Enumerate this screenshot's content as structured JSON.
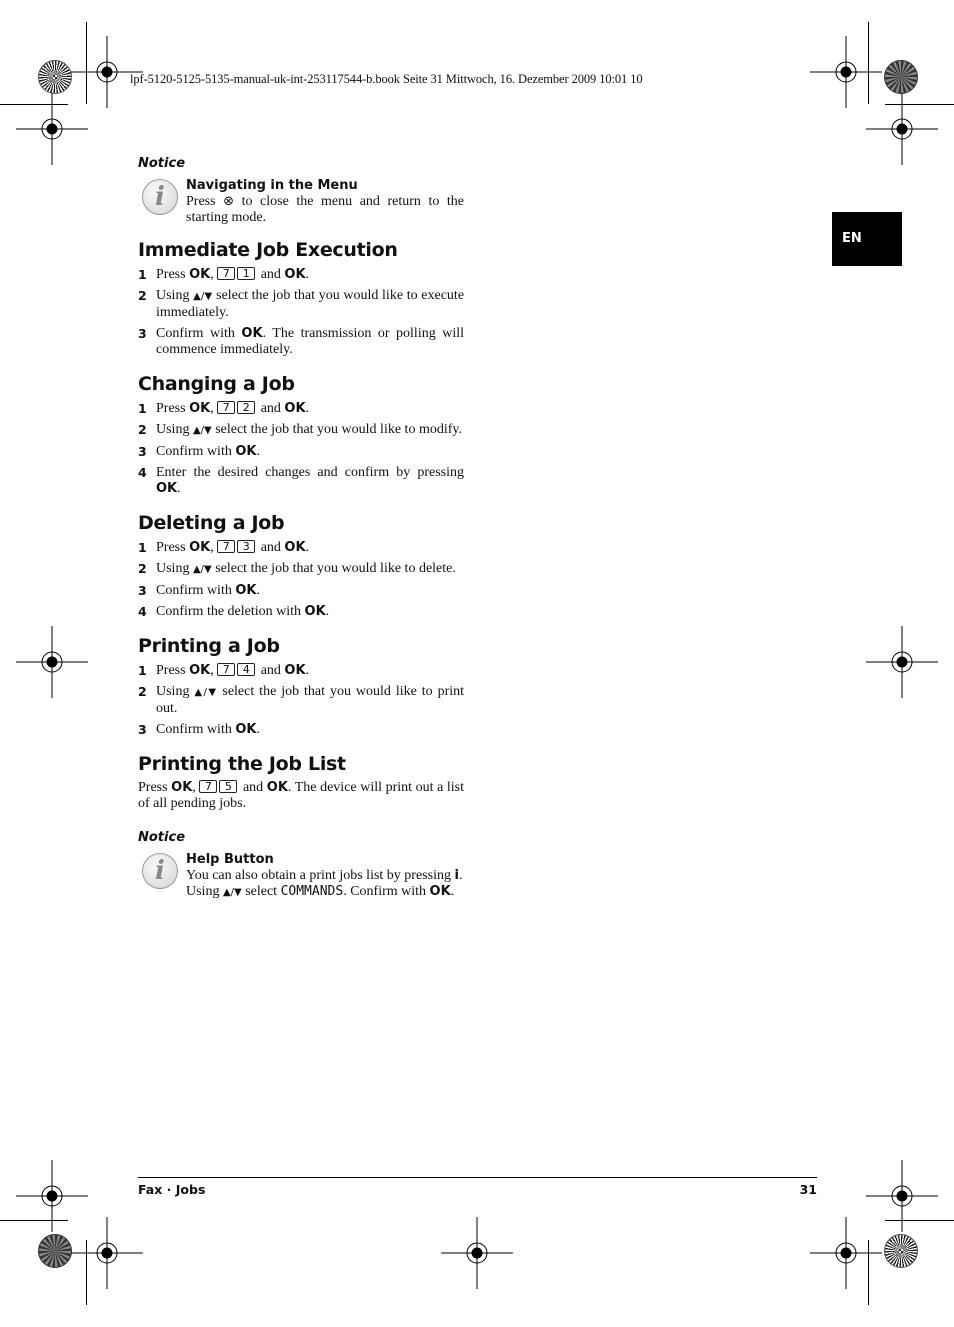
{
  "slug_line": "lpf-5120-5125-5135-manual-uk-int-253117544-b.book  Seite 31  Mittwoch, 16. Dezember 2009  10:01 10",
  "language_tab": "EN",
  "notice1": {
    "label": "Notice",
    "icon": "info-icon",
    "title": "Navigating in the Menu",
    "text_before": "Press",
    "symbol": "⊗",
    "text_after": "to close the menu and return to the starting mode."
  },
  "sections": [
    {
      "title": "Immediate Job Execution",
      "steps": [
        {
          "n": "1",
          "pre": "Press",
          "ok1": "OK",
          "keys": [
            "7",
            "1"
          ],
          "mid": "and",
          "ok2": "OK",
          "end": "."
        },
        {
          "n": "2",
          "pre": "Using",
          "arrows": "▲/▼",
          "text": "select the job that you would like to execute immediately."
        },
        {
          "n": "3",
          "pre": "Confirm with",
          "ok": "OK",
          "text": ". The transmission or polling will commence immediately."
        }
      ]
    },
    {
      "title": "Changing a Job",
      "steps": [
        {
          "n": "1",
          "pre": "Press",
          "ok1": "OK",
          "keys": [
            "7",
            "2"
          ],
          "mid": "and",
          "ok2": "OK",
          "end": "."
        },
        {
          "n": "2",
          "pre": "Using",
          "arrows": "▲/▼",
          "text": "select the job that you would like to modify."
        },
        {
          "n": "3",
          "pre": "Confirm with",
          "ok": "OK",
          "text": "."
        },
        {
          "n": "4",
          "pre": "Enter the desired changes and confirm by pressing",
          "ok": "OK",
          "text": "."
        }
      ]
    },
    {
      "title": "Deleting a Job",
      "steps": [
        {
          "n": "1",
          "pre": "Press",
          "ok1": "OK",
          "keys": [
            "7",
            "3"
          ],
          "mid": "and",
          "ok2": "OK",
          "end": "."
        },
        {
          "n": "2",
          "pre": "Using",
          "arrows": "▲/▼",
          "text": "select the job that you would like to delete."
        },
        {
          "n": "3",
          "pre": "Confirm with",
          "ok": "OK",
          "text": "."
        },
        {
          "n": "4",
          "pre": "Confirm the deletion with",
          "ok": "OK",
          "text": "."
        }
      ]
    },
    {
      "title": "Printing a Job",
      "steps": [
        {
          "n": "1",
          "pre": "Press",
          "ok1": "OK",
          "keys": [
            "7",
            "4"
          ],
          "mid": "and",
          "ok2": "OK",
          "end": "."
        },
        {
          "n": "2",
          "pre": "Using",
          "arrows": "▲/▼",
          "text": "select the job that you would like to print out."
        },
        {
          "n": "3",
          "pre": "Confirm with",
          "ok": "OK",
          "text": "."
        }
      ]
    }
  ],
  "job_list": {
    "title": "Printing the Job List",
    "pre": "Press",
    "ok1": "OK",
    "keys": [
      "7",
      "5"
    ],
    "mid": "and",
    "ok2": "OK",
    "text": ". The device will print out a list of all pending jobs."
  },
  "notice2": {
    "label": "Notice",
    "icon": "info-icon",
    "title": "Help Button",
    "text1": "You can also obtain a print jobs list by pressing",
    "i_key": "i",
    "text2": ". Using",
    "arrows": "▲/▼",
    "text3": "select",
    "lcd": "COMMANDS",
    "text4": ". Confirm with",
    "ok": "OK",
    "end": "."
  },
  "footer": {
    "left": "Fax · Jobs",
    "page": "31"
  }
}
